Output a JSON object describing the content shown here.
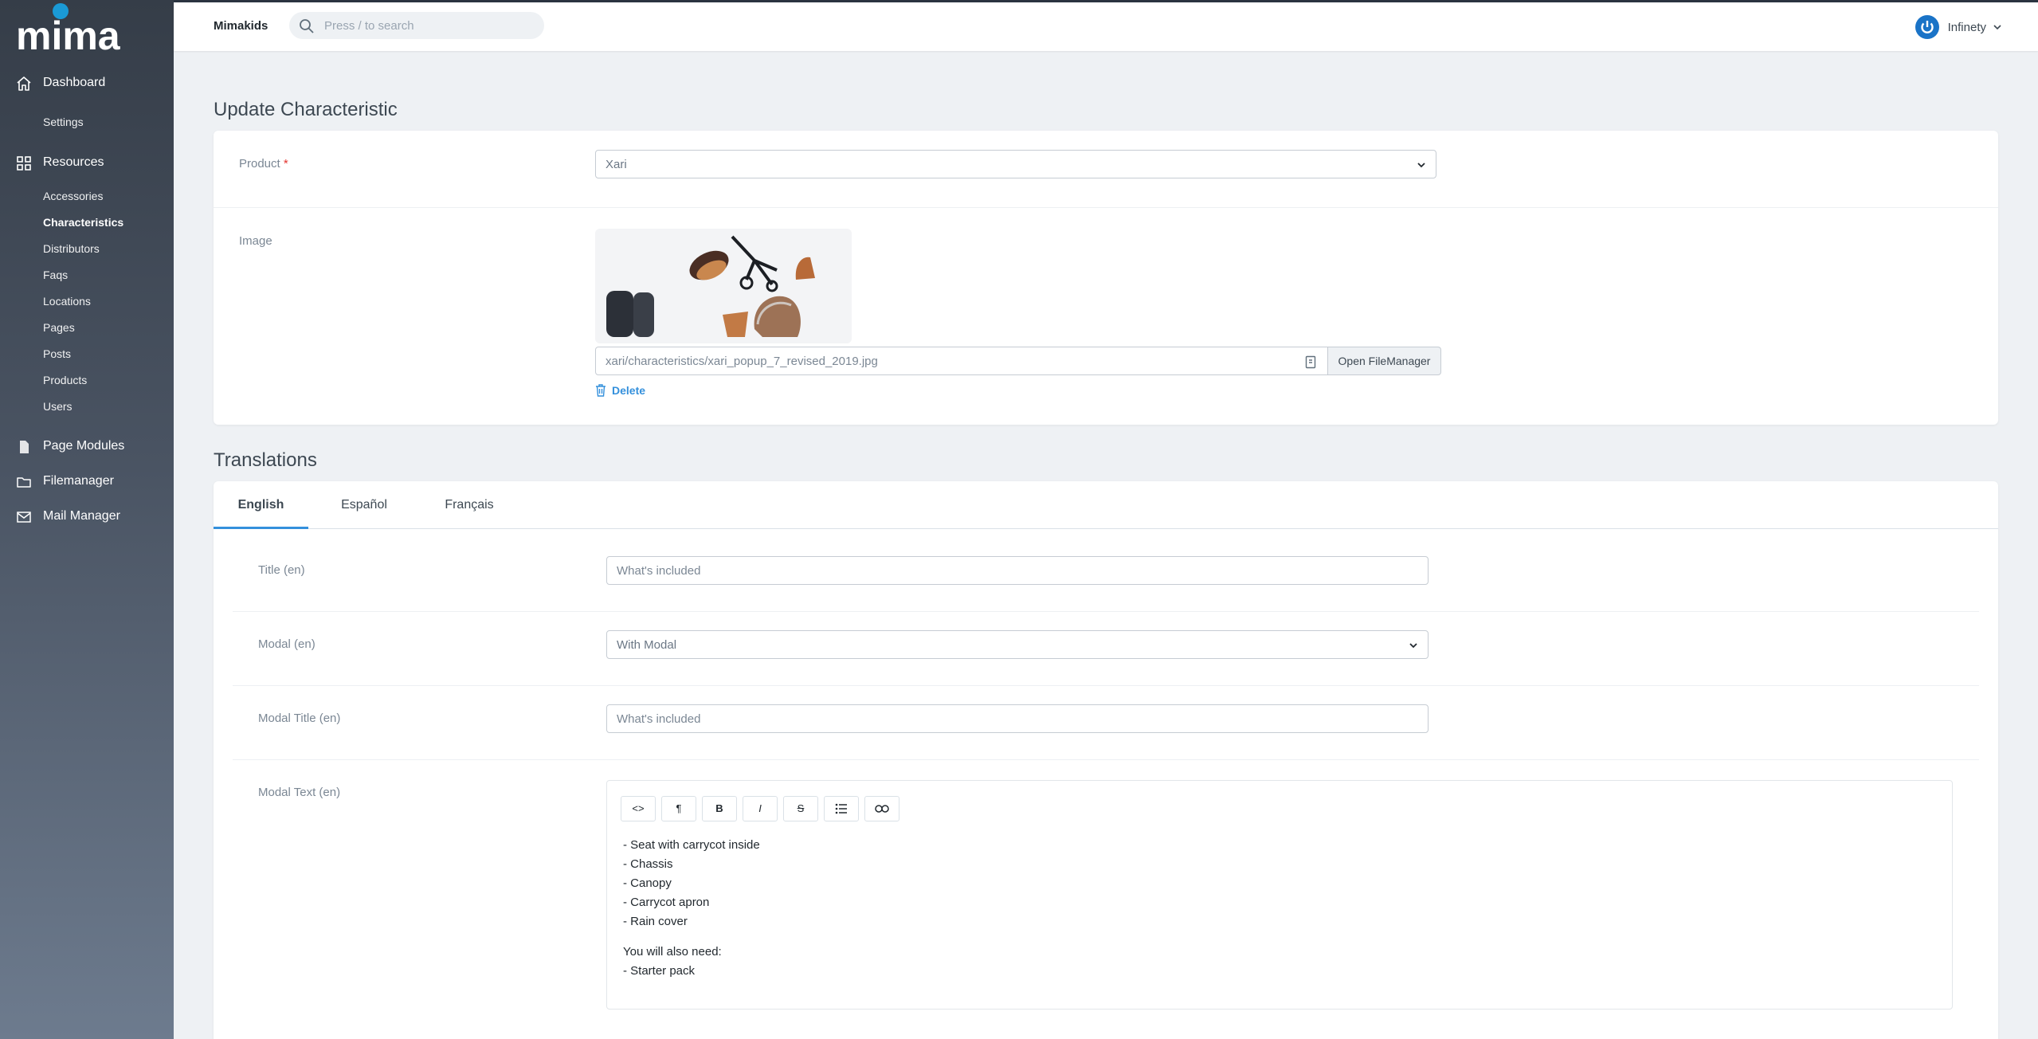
{
  "app": {
    "logo_text": "mima",
    "brand": "Mimakids",
    "search_placeholder": "Press / to search",
    "user_name": "Infinety"
  },
  "sidebar": {
    "dashboard": "Dashboard",
    "settings": "Settings",
    "resources": "Resources",
    "resource_items": [
      "Accessories",
      "Characteristics",
      "Distributors",
      "Faqs",
      "Locations",
      "Pages",
      "Posts",
      "Products",
      "Users"
    ],
    "page_modules": "Page Modules",
    "filemanager": "Filemanager",
    "mail_manager": "Mail Manager"
  },
  "page": {
    "title": "Update Characteristic",
    "product_label": "Product",
    "product_required": "*",
    "product_value": "Xari",
    "image_label": "Image",
    "image_path": "xari/characteristics/xari_popup_7_revised_2019.jpg",
    "open_filemanager": "Open FileManager",
    "delete_label": "Delete"
  },
  "translations": {
    "title": "Translations",
    "tabs": [
      "English",
      "Español",
      "Français"
    ],
    "fields": {
      "title_label": "Title (en)",
      "title_value": "What's included",
      "modal_label": "Modal (en)",
      "modal_value": "With Modal",
      "modal_title_label": "Modal Title (en)",
      "modal_title_value": "What's included",
      "modal_text_label": "Modal Text (en)"
    },
    "editor_toolbar": [
      "<>",
      "¶",
      "B",
      "I",
      "S",
      "list",
      "link"
    ],
    "editor_lines": [
      "- Seat with carrycot inside",
      "- Chassis",
      "- Canopy",
      "- Carrycot apron",
      "- Rain cover",
      "You will also need:",
      "- Starter pack"
    ]
  },
  "colors": {
    "accent": "#3490dc",
    "required": "#e3342f",
    "logo_dot": "#1a9ad6"
  }
}
